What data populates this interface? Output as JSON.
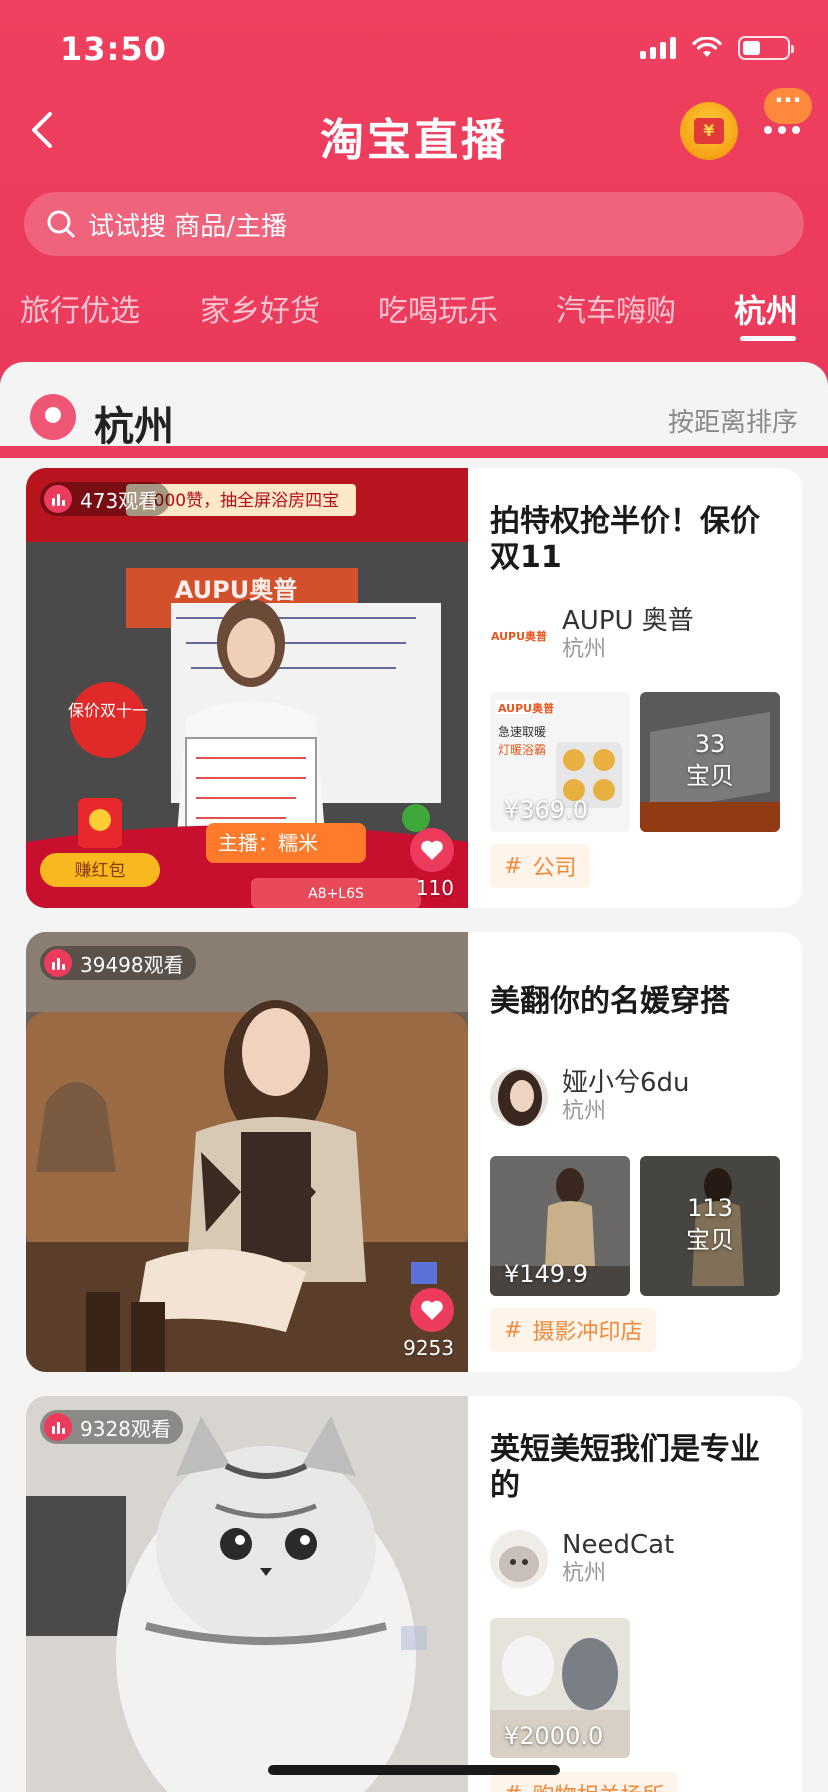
{
  "status": {
    "time": "13:50"
  },
  "nav": {
    "title": "淘宝直播",
    "message_badge": "···"
  },
  "search": {
    "placeholder": "试试搜 商品/主播"
  },
  "tabs": [
    "旅行优选",
    "家乡好货",
    "吃喝玩乐",
    "汽车嗨购",
    "杭州"
  ],
  "active_tab": "杭州",
  "location": {
    "city": "杭州",
    "sort_label": "按距离排序"
  },
  "cards": [
    {
      "viewers": "473观看",
      "banner": "1000赞，抽全屏浴房四宝",
      "brand_sign": "AUPU奥普",
      "host_label": "主播：糯米",
      "red_packet": "赚红包",
      "promo_sticker": "保价双十一",
      "likes": "110",
      "title": "拍特权抢半价！保价双11",
      "anchor_name": "AUPU 奥普",
      "anchor_city": "杭州",
      "products": [
        {
          "price": "¥369.0"
        },
        {
          "count": "33",
          "count_label": "宝贝"
        }
      ],
      "tag": "公司"
    },
    {
      "viewers": "39498观看",
      "likes": "9253",
      "title": "美翻你的名媛穿搭",
      "anchor_name": "娅小兮6du",
      "anchor_city": "杭州",
      "products": [
        {
          "price": "¥149.9"
        },
        {
          "count": "113",
          "count_label": "宝贝"
        }
      ],
      "tag": "摄影冲印店"
    },
    {
      "viewers": "9328观看",
      "title": "英短美短我们是专业的",
      "anchor_name": "NeedCat",
      "anchor_city": "杭州",
      "products": [
        {
          "price": "¥2000.0"
        }
      ],
      "tag": "购物相关场所"
    }
  ],
  "colors": {
    "brand": "#ec3b5c",
    "tag_text": "#f08a3c",
    "tag_bg": "#fff4ea"
  }
}
